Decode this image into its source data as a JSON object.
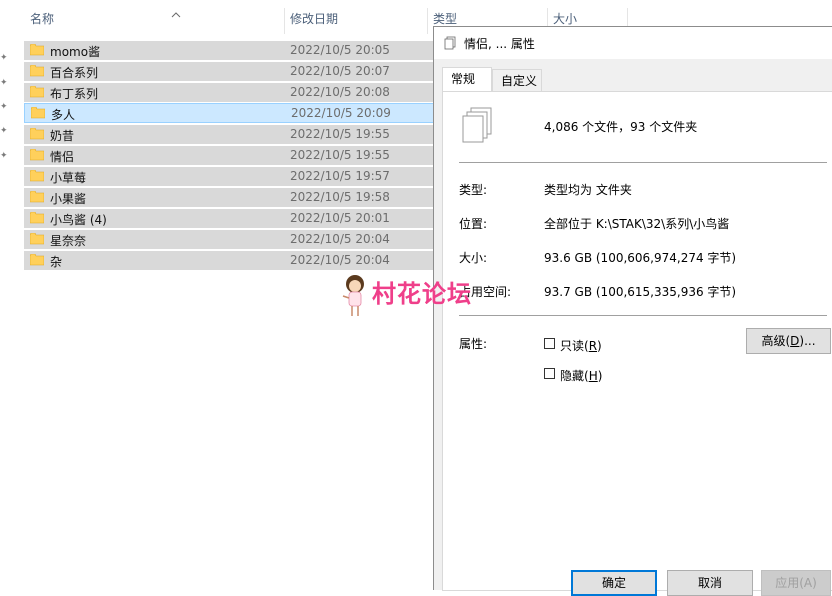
{
  "explorer": {
    "columns": {
      "name": "名称",
      "date": "修改日期",
      "type": "类型",
      "size": "大小"
    },
    "rows": [
      {
        "name": "momo酱",
        "date": "2022/10/5 20:05"
      },
      {
        "name": "百合系列",
        "date": "2022/10/5 20:07"
      },
      {
        "name": "布丁系列",
        "date": "2022/10/5 20:08"
      },
      {
        "name": "多人",
        "date": "2022/10/5 20:09"
      },
      {
        "name": "奶昔",
        "date": "2022/10/5 19:55"
      },
      {
        "name": "情侣",
        "date": "2022/10/5 19:55"
      },
      {
        "name": "小草莓",
        "date": "2022/10/5 19:57"
      },
      {
        "name": "小果酱",
        "date": "2022/10/5 19:58"
      },
      {
        "name": "小鸟酱 (4)",
        "date": "2022/10/5 20:01"
      },
      {
        "name": "星奈奈",
        "date": "2022/10/5 20:04"
      },
      {
        "name": "杂",
        "date": "2022/10/5 20:04"
      }
    ],
    "selected_row": "多人",
    "colors": {
      "row_bg": "#d9d9d9",
      "selected_bg": "#cce8ff",
      "folder": "#ffd05b"
    }
  },
  "watermark": {
    "text": "村花论坛"
  },
  "dialog": {
    "title": "情侣, ... 属性",
    "tabs": [
      {
        "label": "常规",
        "active": true
      },
      {
        "label": "自定义",
        "active": false
      }
    ],
    "summary": "4,086 个文件，93 个文件夹",
    "fields": {
      "type_label": "类型:",
      "type_value": "类型均为 文件夹",
      "location_label": "位置:",
      "location_value": "全部位于 K:\\STAK\\32\\系列\\小鸟酱",
      "size_label": "大小:",
      "size_value": "93.6 GB (100,606,974,274 字节)",
      "disk_label": "占用空间:",
      "disk_value": "93.7 GB (100,615,335,936 字节)",
      "attr_label": "属性:"
    },
    "attributes": {
      "readonly_label": "只读(",
      "readonly_key": "R",
      "readonly_close": ")",
      "hidden_label": "隐藏(",
      "hidden_key": "H",
      "hidden_close": ")",
      "advanced_label": "高级(",
      "advanced_key": "D",
      "advanced_close": ")..."
    },
    "buttons": {
      "ok": "确定",
      "cancel": "取消",
      "apply": "应用(A)"
    },
    "colors": {
      "accent": "#0078d7"
    }
  }
}
